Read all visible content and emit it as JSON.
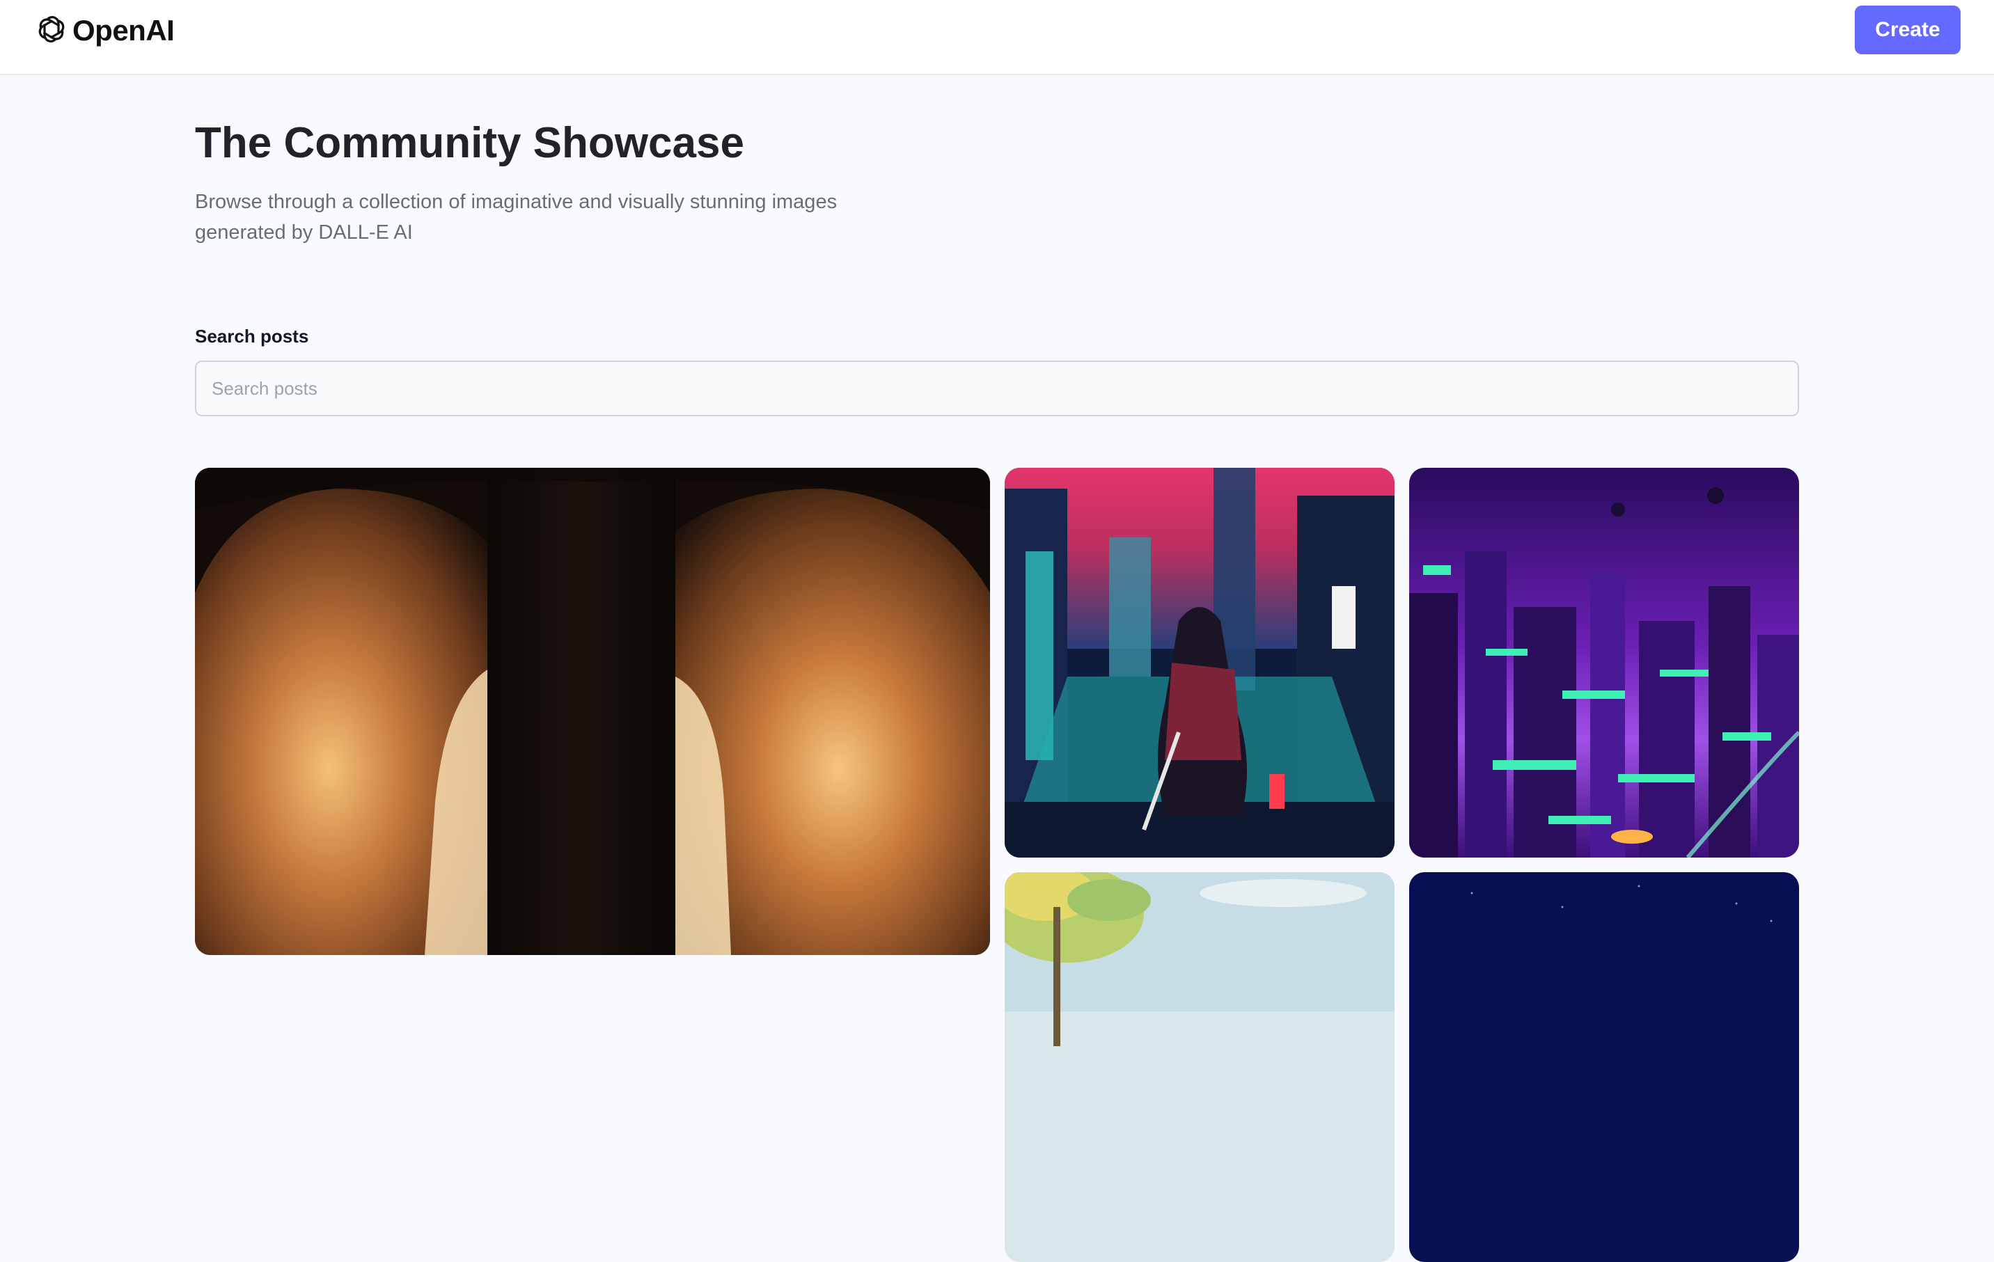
{
  "brand": {
    "name": "OpenAI",
    "icon": "openai-logo-icon"
  },
  "header": {
    "create_label": "Create"
  },
  "hero": {
    "title": "The Community Showcase",
    "subtitle": "Browse through a collection of imaginative and visually stunning images generated by DALL-E AI"
  },
  "search": {
    "label": "Search posts",
    "placeholder": "Search posts",
    "value": ""
  },
  "gallery": {
    "items": [
      {
        "subject": "stone-archway-image"
      },
      {
        "subject": "cyberpunk-samurai-image"
      },
      {
        "subject": "neon-purple-city-image"
      },
      {
        "subject": "watercolor-tree-image"
      },
      {
        "subject": "night-sky-image"
      }
    ]
  },
  "colors": {
    "accent": "#6469ff",
    "background": "#f9fafe",
    "title": "#222328",
    "subtitle": "#666e75"
  }
}
